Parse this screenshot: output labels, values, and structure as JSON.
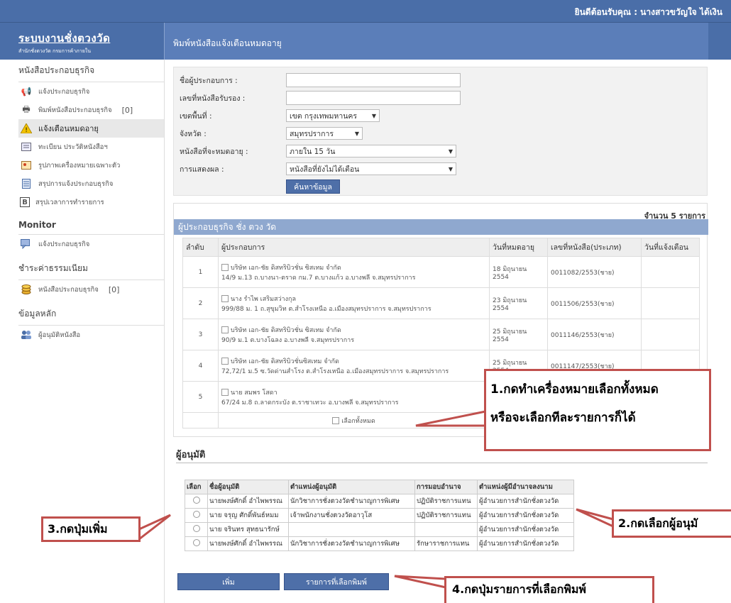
{
  "header": {
    "welcome": "ยินดีต้อนรับคุณ : นางสาวขวัญใจ ได้เงิน",
    "logo_title": "ระบบงานชั่งตวงวัด",
    "logo_subtitle": "สำนักชั่งตวงวัด กรมการค้าภายใน",
    "page_title": "พิมพ์หนังสือแจ้งเตือนหมดอายุ"
  },
  "sidebar": {
    "sections": [
      {
        "title": "หนังสือประกอบธุรกิจ",
        "items": [
          {
            "label": "แจ้งประกอบธุรกิจ",
            "icon": "megaphone-icon",
            "count": ""
          },
          {
            "label": "พิมพ์หนังสือประกอบธุรกิจ",
            "icon": "printer-icon",
            "count": "[0]"
          },
          {
            "label": "แจ้งเตือนหมดอายุ",
            "icon": "warning-icon",
            "count": ""
          },
          {
            "label": "ทะเบียน ประวัติหนังสือฯ",
            "icon": "register-icon",
            "count": ""
          },
          {
            "label": "รูปภาพเครื่องหมายเฉพาะตัว",
            "icon": "image-icon",
            "count": ""
          },
          {
            "label": "สรุปการแจ้งประกอบธุรกิจ",
            "icon": "document-icon",
            "count": ""
          },
          {
            "label": "สรุปเวลาการทำรายการ",
            "icon": "bold-b-icon",
            "count": ""
          }
        ]
      },
      {
        "title": "Monitor",
        "items": [
          {
            "label": "แจ้งประกอบธุรกิจ",
            "icon": "monitor-chat-icon",
            "count": ""
          }
        ]
      },
      {
        "title": "ชำระค่าธรรมเนียม",
        "items": [
          {
            "label": "หนังสือประกอบธุรกิจ",
            "icon": "coins-icon",
            "count": "[0]"
          }
        ]
      },
      {
        "title": "ข้อมูลหลัก",
        "items": [
          {
            "label": "ผู้อนุมัติหนังสือ",
            "icon": "users-icon",
            "count": ""
          }
        ]
      }
    ]
  },
  "form": {
    "operator_label": "ชื่อผู้ประกอบการ :",
    "operator_value": "",
    "cert_label": "เลขที่หนังสือรับรอง :",
    "cert_value": "",
    "district_label": "เขตพื้นที่ :",
    "district_value": "เขต กรุงเทพมหานคร",
    "province_label": "จังหวัด :",
    "province_value": "สมุทรปราการ",
    "expiry_label": "หนังสือที่จะหมดอายุ :",
    "expiry_value": "ภายใน 15 วัน",
    "display_label": "การแสดงผล :",
    "display_value": "หนังสือที่ยังไม่ได้เตือน",
    "search_button": "ค้นหาข้อมูล"
  },
  "results": {
    "count_text": "จำนวน 5 รายการ",
    "title": "ผู้ประกอบธุรกิจ ชั่ง ตวง วัด",
    "columns": [
      "ลำดับ",
      "ผู้ประกอบการ",
      "วันที่หมดอายุ",
      "เลขที่หนังสือ(ประเภท)",
      "วันที่แจ้งเตือน"
    ],
    "rows": [
      {
        "no": "1",
        "name": "บริษัท เอก-ชัย ดิสทริบิวชั่น ซิสเทม จำกัด",
        "address": "14/9 ม.13 ถ.บางนา-ตราด กม.7 ต.บางแก้ว อ.บางพลี จ.สมุทรปราการ",
        "expiry": "18 มิถุนายน 2554",
        "cert": "0011082/2553(ชาย)",
        "notified": ""
      },
      {
        "no": "2",
        "name": "นาง รำไพ เสริมสว่างกุล",
        "address": "999/88 ม. 1 ถ.สุขุมวิท ต.สำโรงเหนือ อ.เมืองสมุทรปราการ จ.สมุทรปราการ",
        "expiry": "23 มิถุนายน 2554",
        "cert": "0011506/2553(ชาย)",
        "notified": ""
      },
      {
        "no": "3",
        "name": "บริษัท เอก-ชัย ดิสทริบิวชั่น ซิสเทม จำกัด",
        "address": "90/9 ม.1 ต.บางโฉลง อ.บางพลี จ.สมุทรปราการ",
        "expiry": "25 มิถุนายน 2554",
        "cert": "0011146/2553(ชาย)",
        "notified": ""
      },
      {
        "no": "4",
        "name": "บริษัท เอก-ชัย ดิสทริบิวชั่นซิสเทม จำกัด",
        "address": "72,72/1 ม.5 ซ.วัดด่านสำโรง ต.สำโรงเหนือ อ.เมืองสมุทรปราการ จ.สมุทรปราการ",
        "expiry": "25 มิถุนายน 2554",
        "cert": "0011147/2553(ชาย)",
        "notified": ""
      },
      {
        "no": "5",
        "name": "นาย สมพร โสดา",
        "address": "67/24 ม.8 ถ.ลาดกระบัง ต.ราชาเทวะ อ.บางพลี จ.สมุทรปราการ",
        "expiry": "",
        "cert": "",
        "notified": ""
      }
    ],
    "select_all_label": "เลือกทั้งหมด"
  },
  "approver": {
    "heading": "ผู้อนุมัติ",
    "columns": [
      "เลือก",
      "ชื่อผู้อนุมัติ",
      "ตำแหน่งผู้อนุมัติ",
      "การมอบอำนาจ",
      "ตำแหน่งผู้มีอำนาจลงนาม"
    ],
    "rows": [
      {
        "name": "นายพงษ์ศักดิ์ อำไพพรรณ",
        "position": "นักวิชาการชั่งตวงวัดชำนาญการพิเศษ",
        "delegation": "ปฏิบัติราชการแทน",
        "signer": "ผู้อำนวยการสำนักชั่งตวงวัด"
      },
      {
        "name": "นาย จรุญ ศักดิ์พันธ์หมม",
        "position": "เจ้าพนักงานชั่งตวงวัดอาวุโส",
        "delegation": "ปฏิบัติราชการแทน",
        "signer": "ผู้อำนวยการสำนักชั่งตวงวัด"
      },
      {
        "name": "นาย จรินทร สุทธนารักษ์",
        "position": "",
        "delegation": "",
        "signer": "ผู้อำนวยการสำนักชั่งตวงวัด"
      },
      {
        "name": "นายพงษ์ศักดิ์ อำไพพรรณ",
        "position": "นักวิชาการชั่งตวงวัดชำนาญการพิเศษ",
        "delegation": "รักษาราชการแทน",
        "signer": "ผู้อำนวยการสำนักชั่งตวงวัด"
      }
    ],
    "add_button": "เพิ่ม",
    "print_list_button": "รายการที่เลือกพิมพ์"
  },
  "callouts": {
    "c1_line1": "1.กดทำเครื่องหมายเลือกทั้งหมด",
    "c1_line2": "หรือจะเลือกทีละรายการก็ได้",
    "c2": "2.กดเลือกผู้อนุมั",
    "c3": "3.กดปุ่มเพิ่ม",
    "c4": "4.กดปุ่มรายการที่เลือกพิมพ์"
  },
  "colors": {
    "header_blue": "#4a6ea8",
    "title_bar": "#5b7eb9",
    "callout_border": "#c0504d"
  }
}
